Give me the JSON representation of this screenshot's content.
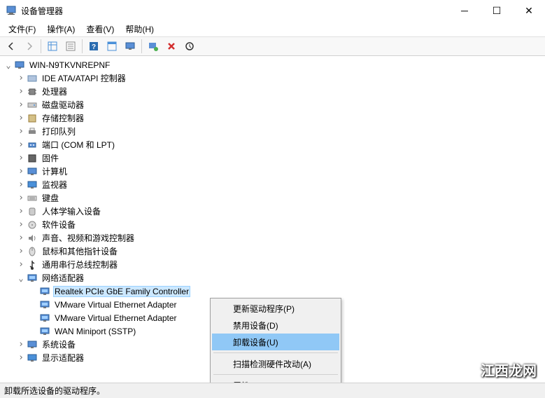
{
  "window": {
    "title": "设备管理器"
  },
  "menubar": {
    "file": "文件(F)",
    "action": "操作(A)",
    "view": "查看(V)",
    "help": "帮助(H)"
  },
  "tree": {
    "root": "WIN-N9TKVNREPNF",
    "categories": [
      {
        "label": "IDE ATA/ATAPI 控制器"
      },
      {
        "label": "处理器"
      },
      {
        "label": "磁盘驱动器"
      },
      {
        "label": "存储控制器"
      },
      {
        "label": "打印队列"
      },
      {
        "label": "端口 (COM 和 LPT)"
      },
      {
        "label": "固件"
      },
      {
        "label": "计算机"
      },
      {
        "label": "监视器"
      },
      {
        "label": "键盘"
      },
      {
        "label": "人体学输入设备"
      },
      {
        "label": "软件设备"
      },
      {
        "label": "声音、视频和游戏控制器"
      },
      {
        "label": "鼠标和其他指针设备"
      },
      {
        "label": "通用串行总线控制器"
      },
      {
        "label": "网络适配器",
        "expanded": true,
        "children": [
          {
            "label": "Realtek PCIe GbE Family Controller",
            "selected": true
          },
          {
            "label": "VMware Virtual Ethernet Adapter"
          },
          {
            "label": "VMware Virtual Ethernet Adapter"
          },
          {
            "label": "WAN Miniport (SSTP)"
          }
        ]
      },
      {
        "label": "系统设备"
      },
      {
        "label": "显示适配器"
      }
    ]
  },
  "context_menu": {
    "update_driver": "更新驱动程序(P)",
    "disable_device": "禁用设备(D)",
    "uninstall_device": "卸载设备(U)",
    "scan_hardware": "扫描检测硬件改动(A)",
    "properties": "属性(R)"
  },
  "statusbar": {
    "text": "卸载所选设备的驱动程序。"
  },
  "watermark": "江西龙网"
}
